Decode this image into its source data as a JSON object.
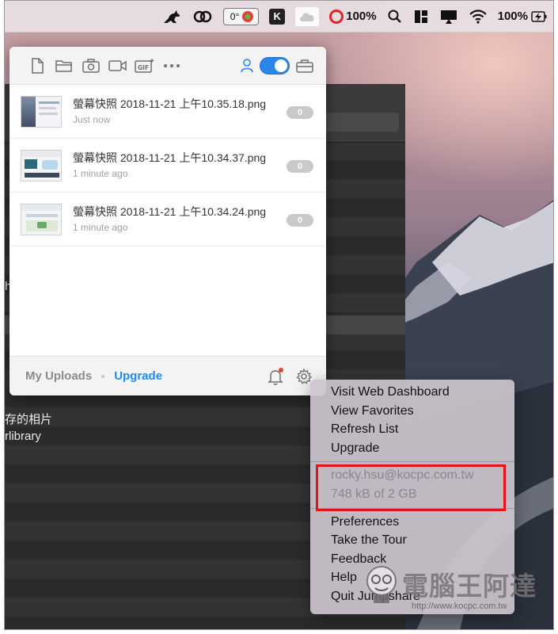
{
  "menubar": {
    "temp": "0°",
    "battery_app_pct": "100%",
    "battery_pct": "100%",
    "k_label": "K"
  },
  "panel": {
    "toolbar_icons": [
      "new-file-icon",
      "folder-icon",
      "camera-icon",
      "video-icon",
      "gif-icon",
      "more-icon"
    ],
    "gif_label": "GIF",
    "files": [
      {
        "name": "螢幕快照 2018-11-21 上午10.35.18.png",
        "time": "Just now",
        "count": "0"
      },
      {
        "name": "螢幕快照 2018-11-21 上午10.34.37.png",
        "time": "1 minute ago",
        "count": "0"
      },
      {
        "name": "螢幕快照 2018-11-21 上午10.34.24.png",
        "time": "1 minute ago",
        "count": "0"
      }
    ],
    "footer": {
      "my_uploads": "My Uploads",
      "upgrade": "Upgrade"
    }
  },
  "background_window": {
    "line1": "存的相片",
    "line2": "rlibrary",
    "edge_char": "h"
  },
  "menu": {
    "group1": [
      "Visit Web Dashboard",
      "View Favorites",
      "Refresh List",
      "Upgrade"
    ],
    "account_email": "rocky.hsu@kocpc.com.tw",
    "storage": "748 kB of 2 GB",
    "group3": [
      "Preferences",
      "Take the Tour",
      "Feedback",
      "Help",
      "Quit Jumpshare"
    ]
  },
  "watermark": {
    "text": "電腦王阿達",
    "url": "http://www.kocpc.com.tw"
  },
  "colors": {
    "accent": "#2a86e8",
    "highlight_box": "#e0131e"
  }
}
